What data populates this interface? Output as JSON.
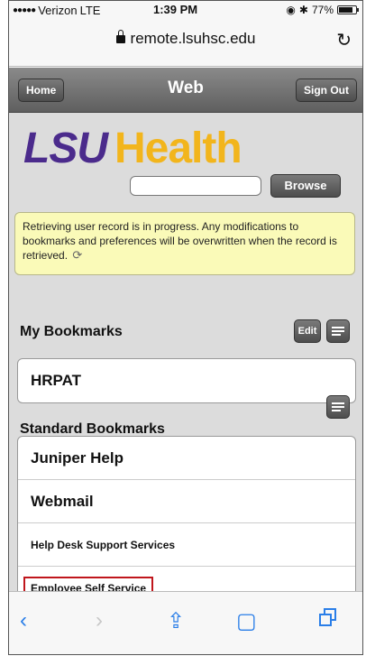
{
  "status_bar": {
    "carrier": "Verizon",
    "network": "LTE",
    "time": "1:39 PM",
    "battery": "77%"
  },
  "address_bar": {
    "url": "remote.lsuhsc.edu",
    "reload_icon": "reload-icon"
  },
  "header": {
    "home_label": "Home",
    "title": "Web",
    "sign_out_label": "Sign Out"
  },
  "logo": {
    "part1": "LSU",
    "part2": "Health"
  },
  "browse": {
    "input_value": "",
    "button_label": "Browse"
  },
  "notice": {
    "text": "Retrieving user record is in progress. Any modifications to bookmarks and preferences will be overwritten when the record is retrieved."
  },
  "my_bookmarks": {
    "title": "My Bookmarks",
    "edit_label": "Edit",
    "items": [
      "HRPAT"
    ]
  },
  "standard_bookmarks": {
    "title": "Standard Bookmarks",
    "items": [
      "Juniper Help",
      "Webmail",
      "Help Desk Support Services",
      "Employee Self Service"
    ]
  },
  "colors": {
    "lsu_purple": "#4b2b8c",
    "lsu_gold": "#f2b51c",
    "ios_blue": "#2a7ee8",
    "highlight_red": "#c0161c"
  }
}
